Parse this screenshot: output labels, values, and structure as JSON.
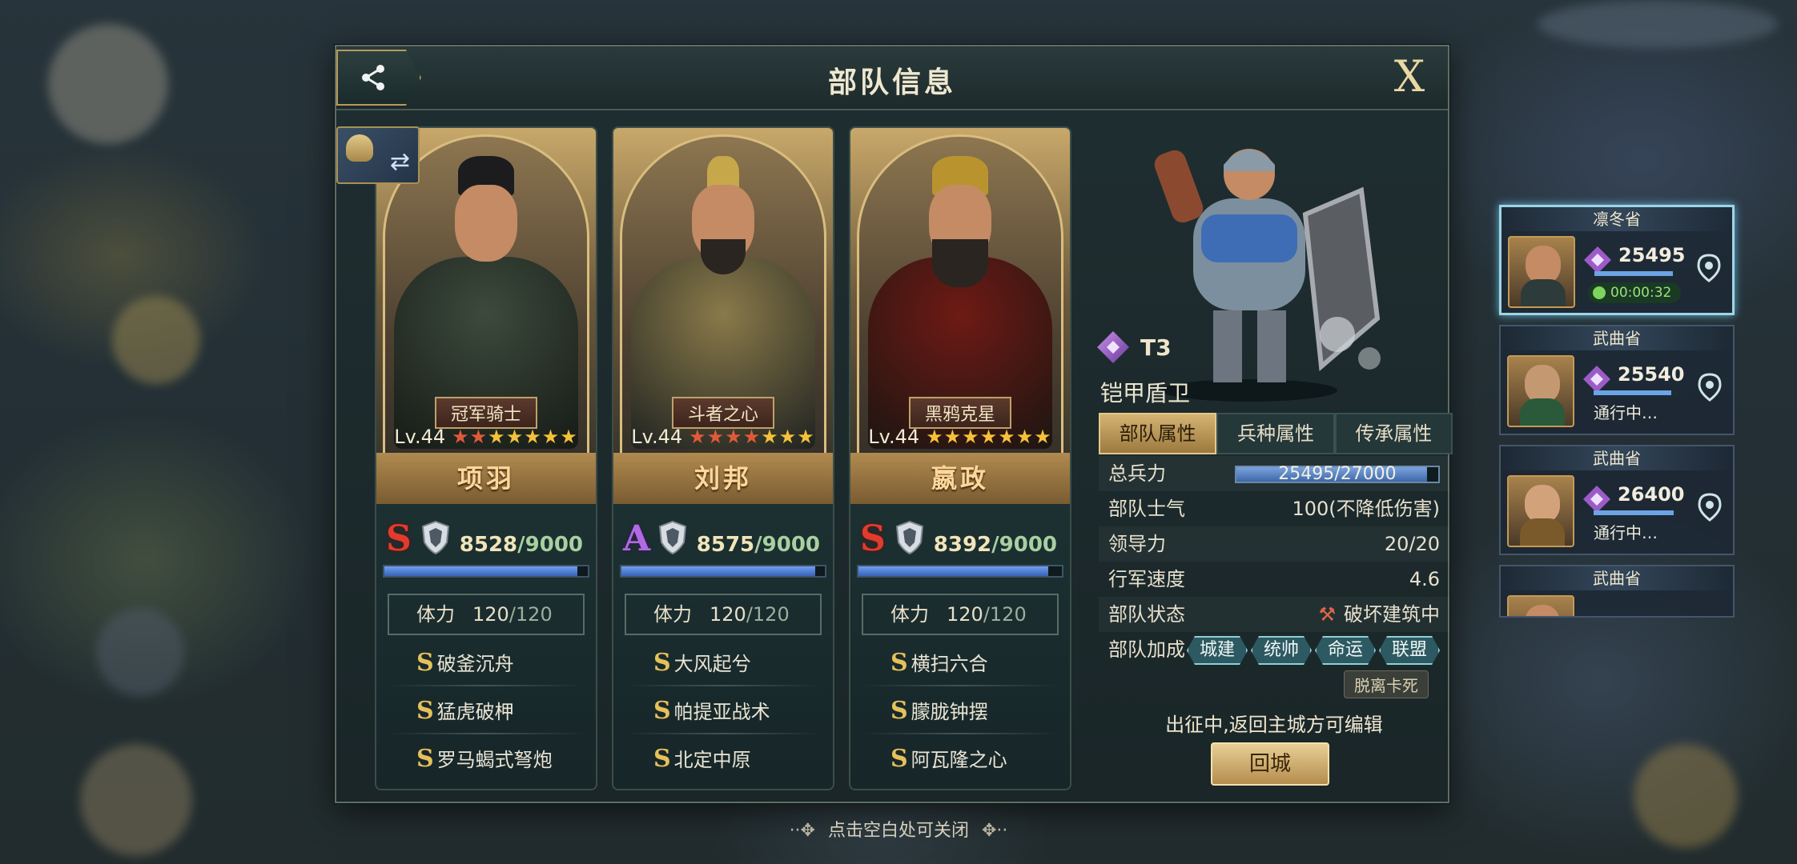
{
  "panel": {
    "title": "部队信息",
    "close_label": "X"
  },
  "heroes": [
    {
      "name": "项羽",
      "title_ribbon": "冠军骑士",
      "level": "Lv.44",
      "grade": "S",
      "troops_current": "8528",
      "troops_max": "/9000",
      "troops_fraction": 0.9476,
      "stamina_label": "体力",
      "stamina_current": "120",
      "stamina_max": "/120",
      "skills": [
        "破釜沉舟",
        "猛虎破柙",
        "罗马蝎式弩炮"
      ]
    },
    {
      "name": "刘邦",
      "title_ribbon": "斗者之心",
      "level": "Lv.44",
      "grade": "A",
      "troops_current": "8575",
      "troops_max": "/9000",
      "troops_fraction": 0.9528,
      "stamina_label": "体力",
      "stamina_current": "120",
      "stamina_max": "/120",
      "skills": [
        "大风起兮",
        "帕提亚战术",
        "北定中原"
      ]
    },
    {
      "name": "嬴政",
      "title_ribbon": "黑鸦克星",
      "level": "Lv.44",
      "grade": "S",
      "troops_current": "8392",
      "troops_max": "/9000",
      "troops_fraction": 0.9324,
      "stamina_label": "体力",
      "stamina_current": "120",
      "stamina_max": "/120",
      "skills": [
        "横扫六合",
        "朦胧钟摆",
        "阿瓦隆之心"
      ]
    }
  ],
  "unit": {
    "tier": "T3",
    "name": "铠甲盾卫",
    "tabs": [
      "部队属性",
      "兵种属性",
      "传承属性"
    ],
    "active_tab": 0,
    "stats": {
      "total_troops_label": "总兵力",
      "total_troops_value": "25495/27000",
      "total_troops_fraction": 0.944,
      "morale_label": "部队士气",
      "morale_value": "100(不降低伤害)",
      "leadership_label": "领导力",
      "leadership_value": "20/20",
      "speed_label": "行军速度",
      "speed_value": "4.6",
      "status_label": "部队状态",
      "status_value": "破坏建筑中",
      "bonus_label": "部队加成",
      "bonus_tags": [
        "城建",
        "统帅",
        "命运",
        "联盟"
      ]
    },
    "unstuck_label": "脱离卡死",
    "edit_note": "出征中,返回主城方可编辑",
    "recall_label": "回城"
  },
  "tap_to_close": "点击空白处可关闭",
  "marches": [
    {
      "region": "凛冬省",
      "troops": "25495",
      "fraction": 0.944,
      "status": "00:00:32",
      "type": "timer",
      "selected": true
    },
    {
      "region": "武曲省",
      "troops": "25540",
      "fraction": 0.93,
      "status": "通行中…",
      "type": "text",
      "selected": false
    },
    {
      "region": "武曲省",
      "troops": "26400",
      "fraction": 0.96,
      "status": "通行中…",
      "type": "text",
      "selected": false
    },
    {
      "region": "武曲省",
      "troops": "",
      "fraction": 0,
      "status": "",
      "type": "text",
      "selected": false
    }
  ],
  "colors": {
    "accent_gold": "#d4b373",
    "grade_s": "#e23b2e",
    "grade_a": "#b16ae2",
    "bar_blue": "#6fa0f0"
  },
  "icons": {
    "share": "share-icon",
    "swap": "swap-formation-icon",
    "shield": "shield-icon",
    "gem": "tier-gem-icon",
    "location": "location-pin-icon"
  }
}
